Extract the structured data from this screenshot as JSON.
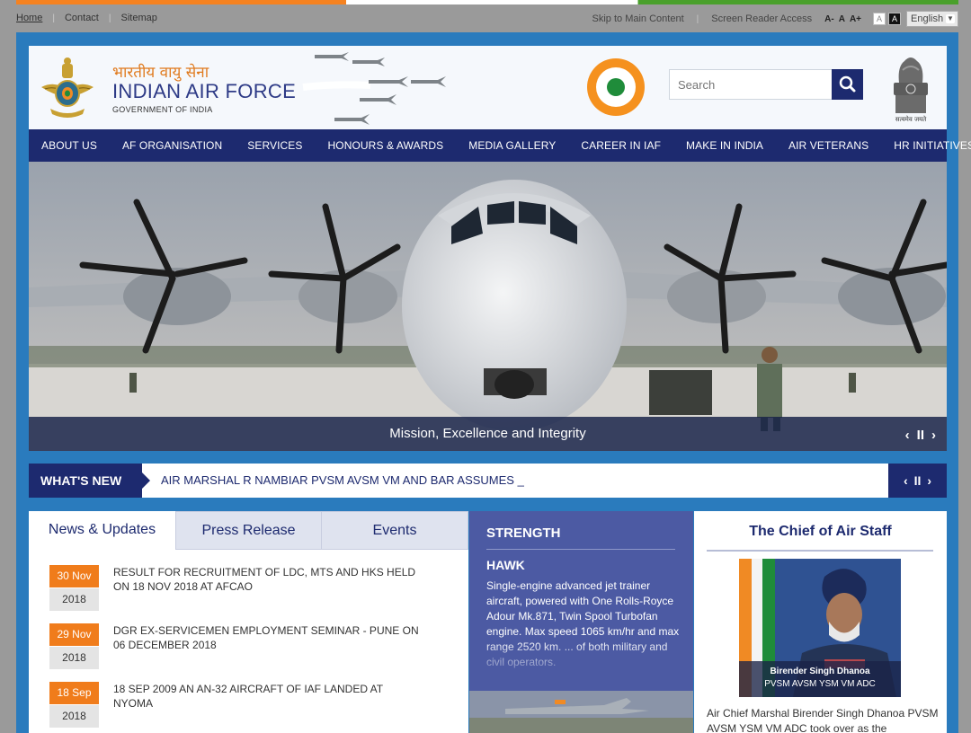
{
  "topbar": {
    "links": [
      "Home",
      "Contact",
      "Sitemap"
    ],
    "skip_link": "Skip to Main Content",
    "screen_reader": "Screen Reader Access",
    "font_small": "A-",
    "font_normal": "A",
    "font_large": "A+",
    "contrast_light": "A",
    "contrast_dark": "A",
    "language": "English"
  },
  "header": {
    "title_hindi": "भारतीय वायु सेना",
    "title": "INDIAN AIR FORCE",
    "subtitle": "GOVERNMENT OF INDIA",
    "search_placeholder": "Search",
    "emblem_motto": "सत्यमेव जयते"
  },
  "nav": {
    "items": [
      "ABOUT US",
      "AF ORGANISATION",
      "SERVICES",
      "HONOURS & AWARDS",
      "MEDIA GALLERY",
      "CAREER IN IAF",
      "MAKE IN INDIA",
      "AIR VETERANS",
      "HR INITIATIVES"
    ]
  },
  "hero": {
    "caption": "Mission, Excellence and Integrity",
    "prev": "‹",
    "pause": "II",
    "next": "›"
  },
  "whats_new": {
    "label": "WHAT'S NEW",
    "text": "AIR MARSHAL R NAMBIAR PVSM AVSM VM AND BAR ASSUMES _",
    "prev": "‹",
    "pause": "II",
    "next": "›"
  },
  "news": {
    "tabs": [
      "News & Updates",
      "Press Release",
      "Events"
    ],
    "items": [
      {
        "date": "30 Nov",
        "year": "2018",
        "text": "RESULT FOR RECRUITMENT OF LDC, MTS AND HKS HELD ON 18 NOV 2018 AT AFCAO"
      },
      {
        "date": "29 Nov",
        "year": "2018",
        "text": "DGR EX-SERVICEMEN EMPLOYMENT SEMINAR - PUNE ON 06 DECEMBER 2018"
      },
      {
        "date": "18 Sep",
        "year": "2018",
        "text": "18 SEP 2009 AN AN-32 AIRCRAFT OF IAF LANDED AT NYOMA"
      }
    ]
  },
  "strength": {
    "title": "STRENGTH",
    "aircraft": "HAWK",
    "description": "Single-engine advanced jet trainer aircraft, powered with One Rolls-Royce Adour Mk.871, Twin Spool Turbofan engine. Max speed 1065 km/hr and max range 2520 km. ... of both military and civil operators."
  },
  "chief": {
    "title": "The Chief of Air Staff",
    "name": "Birender Singh Dhanoa",
    "honours": "PVSM AVSM YSM VM ADC",
    "description": "Air Chief Marshal Birender Singh Dhanoa PVSM AVSM YSM VM ADC took over as the"
  },
  "colors": {
    "navy": "#1d2a6f",
    "frame_blue": "#2a7bbd",
    "saffron": "#f07c1b",
    "green": "#1f8c3a",
    "strength_bg": "#4c5aa3"
  }
}
